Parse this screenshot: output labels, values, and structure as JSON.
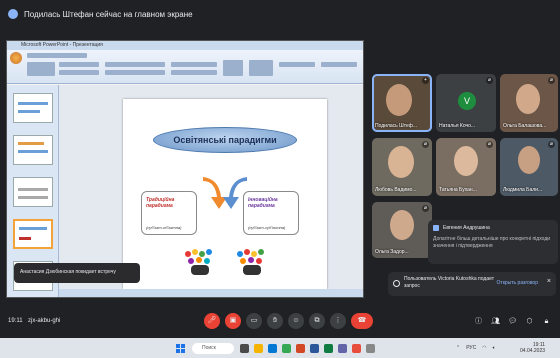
{
  "banner": {
    "text": "Подилась Штефан сейчас на главном экране"
  },
  "presentation": {
    "window_title": "Microsoft PowerPoint - Презентация",
    "slide": {
      "title": "Освітянські парадигми",
      "left_box": {
        "title": "Традиційна парадигма",
        "subtitle": "(субʼєкт-обʼєктна)"
      },
      "right_box": {
        "title": "Інноваційна парадигма",
        "subtitle": "(субʼєкт-субʼєктна)"
      }
    }
  },
  "notice": {
    "text": "Анастасия Дзюбинская покидает встречу"
  },
  "participants": [
    {
      "name": "Подилась Штеф..."
    },
    {
      "name": "Наталья Кочо...",
      "initial": "V"
    },
    {
      "name": "Ольга Балашова..."
    },
    {
      "name": "Любовь Вадимо..."
    },
    {
      "name": "Татьяна Бухан..."
    },
    {
      "name": "Людмила Бали..."
    },
    {
      "name": "Ольга Задор..."
    }
  ],
  "chat": {
    "sender": "Евгения Андрушина",
    "message": "Допагітне більш детальніше про конкретні підходи значення і підтвердження"
  },
  "join_request": {
    "text": "Пользователь Victoria Kutoshka подает запрос",
    "button": "Открыть разговор"
  },
  "meet": {
    "time": "19:11",
    "meeting_code": "zjx-akbu-ghi"
  },
  "taskbar": {
    "search_placeholder": "Поиск",
    "tray_lang": "РУС",
    "time": "19:11",
    "date": "04.04.2023"
  },
  "colors": {
    "meet_bg": "#202124",
    "hangup": "#ea4335",
    "accent": "#8ab4f8"
  }
}
